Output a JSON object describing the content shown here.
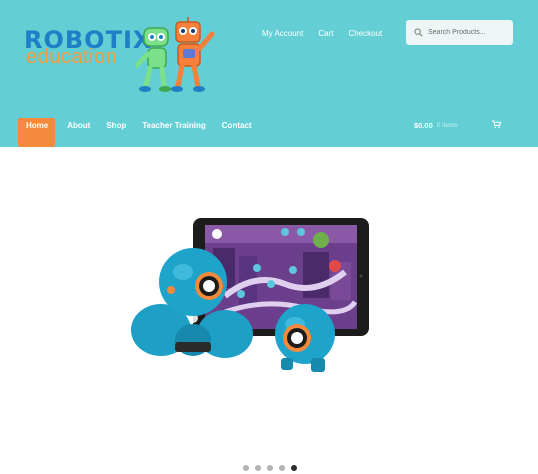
{
  "logo": {
    "word1": "ROBOTIX",
    "word2": "education"
  },
  "top_links": [
    "My Account",
    "Cart",
    "Checkout"
  ],
  "search": {
    "placeholder": "Search Products..."
  },
  "nav": {
    "items": [
      {
        "label": "Home",
        "active": true
      },
      {
        "label": "About"
      },
      {
        "label": "Shop"
      },
      {
        "label": "Teacher Training"
      },
      {
        "label": "Contact"
      }
    ]
  },
  "cart": {
    "total": "$0.00",
    "count": "0 items"
  },
  "slider": {
    "dot_count": 5,
    "active_index": 4
  },
  "colors": {
    "header_bg": "#63cfd4",
    "accent": "#f58a3c",
    "logo_blue": "#1f7fc6",
    "logo_orange": "#f59b3a"
  }
}
